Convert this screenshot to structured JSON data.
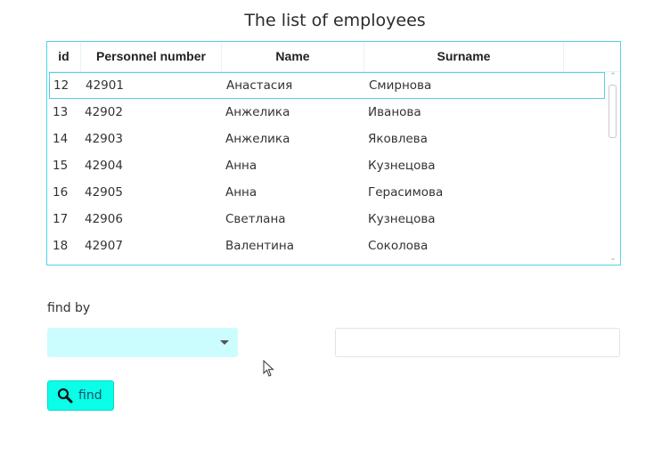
{
  "page": {
    "title": "The list of employees"
  },
  "table": {
    "columns": [
      "id",
      "Personnel number",
      "Name",
      "Surname"
    ],
    "rows": [
      {
        "id": "12",
        "personnel_number": "42901",
        "name": "Анастасия",
        "surname": "Смирнова"
      },
      {
        "id": "13",
        "personnel_number": "42902",
        "name": "Анжелика",
        "surname": "Иванова"
      },
      {
        "id": "14",
        "personnel_number": "42903",
        "name": "Анжелика",
        "surname": "Яковлева"
      },
      {
        "id": "15",
        "personnel_number": "42904",
        "name": "Анна",
        "surname": "Кузнецова"
      },
      {
        "id": "16",
        "personnel_number": "42905",
        "name": "Анна",
        "surname": "Герасимова"
      },
      {
        "id": "17",
        "personnel_number": "42906",
        "name": "Светлана",
        "surname": "Кузнецова"
      },
      {
        "id": "18",
        "personnel_number": "42907",
        "name": "Валентина",
        "surname": "Соколова"
      }
    ],
    "selected_row": 0
  },
  "search": {
    "label": "find by",
    "field_selected": "",
    "query_value": "",
    "button_label": "find",
    "button_icon": "search-icon"
  },
  "colors": {
    "accent": "#0affe9",
    "select_bg": "#ccfdfe",
    "grid_border": "#4fd3e6"
  }
}
